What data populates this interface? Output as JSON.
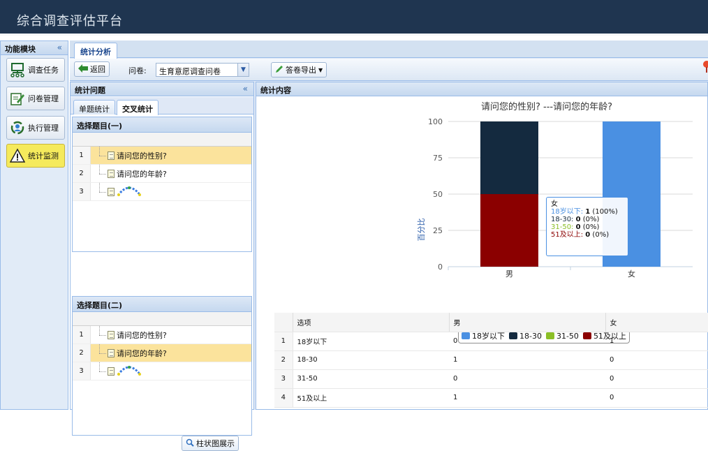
{
  "app": {
    "title": "综合调查评估平台"
  },
  "modules": {
    "header": "功能模块",
    "collapse": "«",
    "items": [
      {
        "label": "调查任务",
        "icon": "task-icon"
      },
      {
        "label": "问卷管理",
        "icon": "edit-icon"
      },
      {
        "label": "执行管理",
        "icon": "refresh-icon"
      },
      {
        "label": "统计监测",
        "icon": "warning-icon",
        "active": true
      }
    ]
  },
  "tabs": {
    "main": "统计分析"
  },
  "toolbar": {
    "back": "返回",
    "survey_label": "问卷:",
    "survey_value": "生育意愿调查问卷",
    "export": "答卷导出"
  },
  "question_panel": {
    "header": "统计问题",
    "collapse": "«",
    "tabs": [
      "单题统计",
      "交叉统计"
    ],
    "box1": {
      "title": "选择题目(一)",
      "rows": [
        {
          "num": "1",
          "label": "请问您的性别?",
          "highlight": true
        },
        {
          "num": "2",
          "label": "请问您的年龄?",
          "highlight": false
        },
        {
          "num": "3",
          "label": "",
          "highlight": false
        }
      ]
    },
    "box2": {
      "title": "选择题目(二)",
      "rows": [
        {
          "num": "1",
          "label": "请问您的性别?",
          "highlight": false
        },
        {
          "num": "2",
          "label": "请问您的年龄?",
          "highlight": true
        },
        {
          "num": "3",
          "label": "",
          "highlight": false
        }
      ]
    },
    "chart_button": "柱状图展示"
  },
  "content_panel": {
    "header": "统计内容"
  },
  "chart_data": {
    "type": "bar",
    "stacked": true,
    "title": "请问您的性别? ---请问您的年龄?",
    "ylabel": "百分比",
    "xlabel": "",
    "ylim": [
      0,
      100
    ],
    "yticks": [
      "0",
      "25",
      "50",
      "75",
      "100"
    ],
    "categories": [
      "男",
      "女"
    ],
    "series": [
      {
        "name": "18岁以下",
        "color": "#4a90e2",
        "values": [
          0,
          100
        ]
      },
      {
        "name": "18-30",
        "color": "#142a3f",
        "values": [
          50,
          0
        ]
      },
      {
        "name": "31-50",
        "color": "#8bbf26",
        "values": [
          0,
          0
        ]
      },
      {
        "name": "51及以上",
        "color": "#8b0000",
        "values": [
          50,
          0
        ]
      }
    ],
    "tooltip": {
      "title": "女",
      "lines": [
        {
          "label": "18岁以下: ",
          "value": "1",
          "pct": " (100%)",
          "color": "#4a90e2"
        },
        {
          "label": "18-30: ",
          "value": "0",
          "pct": " (0%)",
          "color": "#142a3f"
        },
        {
          "label": "31-50: ",
          "value": "0",
          "pct": " (0%)",
          "color": "#8bbf26"
        },
        {
          "label": "51及以上: ",
          "value": "0",
          "pct": " (0%)",
          "color": "#8b0000"
        }
      ]
    }
  },
  "table": {
    "headers": [
      "选项",
      "男",
      "女"
    ],
    "rows": [
      [
        "1",
        "18岁以下",
        "0",
        "1"
      ],
      [
        "2",
        "18-30",
        "1",
        "0"
      ],
      [
        "3",
        "31-50",
        "0",
        "0"
      ],
      [
        "4",
        "51及以上",
        "1",
        "0"
      ]
    ]
  }
}
